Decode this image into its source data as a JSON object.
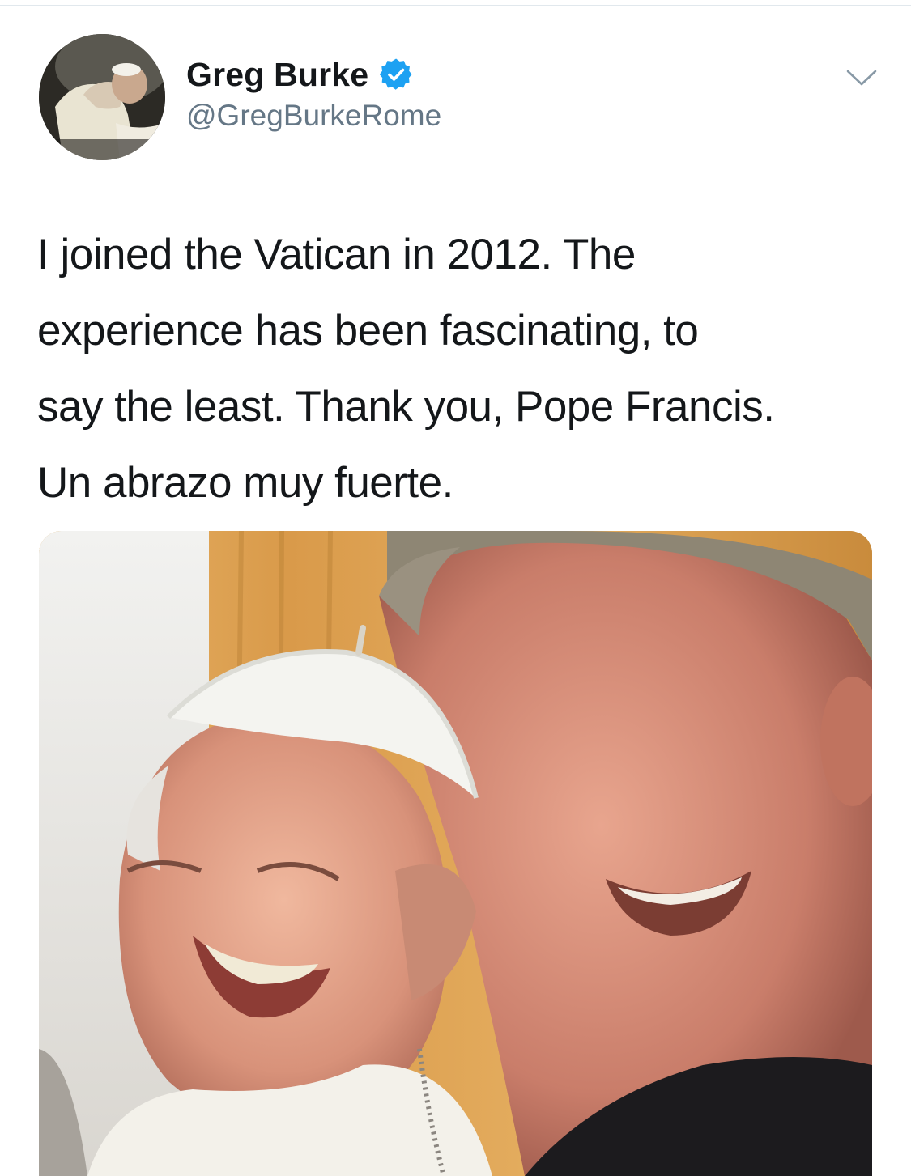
{
  "tweet": {
    "author": {
      "display_name": "Greg Burke",
      "handle": "@GregBurkeRome",
      "verified": true
    },
    "text_lines": [
      "I joined the Vatican in 2012. The",
      "experience has been fascinating, to",
      "say the least. Thank you, Pope Francis.",
      "Un abrazo muy fuerte."
    ],
    "icons": {
      "verified": "verified-badge-icon",
      "caret": "chevron-down-icon"
    }
  },
  "colors": {
    "verified_blue": "#1da1f2",
    "handle_gray": "#657786",
    "text": "#14171a",
    "caret_gray": "#8899a6"
  }
}
